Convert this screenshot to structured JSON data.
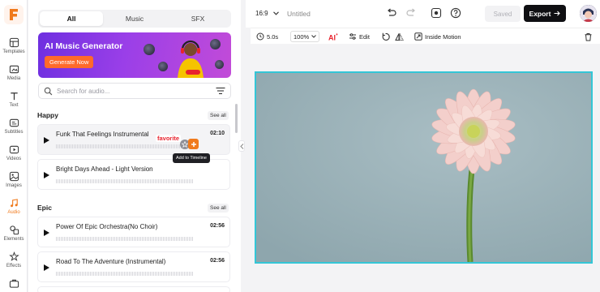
{
  "rail": {
    "items": [
      {
        "label": "Templates",
        "icon": "templates-icon"
      },
      {
        "label": "Media",
        "icon": "media-icon"
      },
      {
        "label": "Text",
        "icon": "text-icon"
      },
      {
        "label": "Subtitles",
        "icon": "subtitles-icon"
      },
      {
        "label": "Videos",
        "icon": "videos-icon"
      },
      {
        "label": "Images",
        "icon": "images-icon"
      },
      {
        "label": "Audio",
        "icon": "audio-icon",
        "active": true
      },
      {
        "label": "Elements",
        "icon": "elements-icon"
      },
      {
        "label": "Effects",
        "icon": "effects-icon"
      }
    ]
  },
  "panel": {
    "tabs": [
      "All",
      "Music",
      "SFX"
    ],
    "active_tab": "All",
    "banner": {
      "title": "AI Music Generator",
      "button": "Generate Now"
    },
    "search": {
      "placeholder": "Search for audio..."
    },
    "sections": [
      {
        "title": "Happy",
        "see_all": "See all",
        "tracks": [
          {
            "name": "Funk That Feelings Instrumental",
            "duration": "02:10"
          },
          {
            "name": "Bright Days Ahead - Light Version",
            "duration": ""
          }
        ]
      },
      {
        "title": "Epic",
        "see_all": "See all",
        "tracks": [
          {
            "name": "Power Of Epic Orchestra(No Choir)",
            "duration": "02:56"
          },
          {
            "name": "Road To The Adventure (Instrumental)",
            "duration": "02:56"
          }
        ]
      }
    ],
    "favorite_label": "favorite",
    "add_tooltip": "Add to Timeline"
  },
  "topbar": {
    "ratio": "16:9",
    "title": "Untitled",
    "saved": "Saved",
    "export": "Export"
  },
  "toolbar": {
    "duration": "5.0s",
    "zoom": "100%",
    "edit": "Edit",
    "inside_motion": "Inside Motion"
  },
  "colors": {
    "accent": "#f07a1c",
    "selection": "#34c6d6",
    "canvas_bg": "#9bb1b7"
  }
}
